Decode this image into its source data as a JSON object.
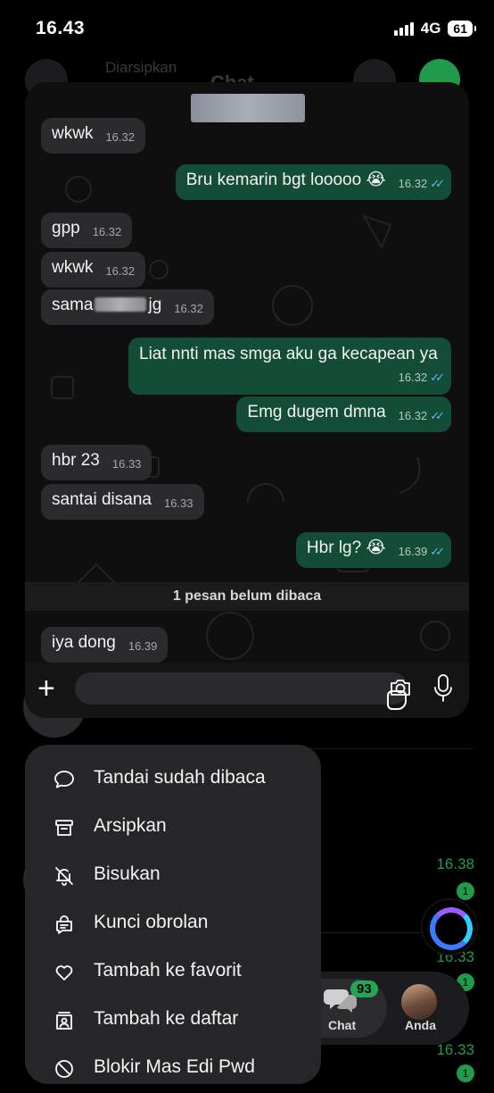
{
  "status": {
    "time": "16.43",
    "network": "4G",
    "battery": "61"
  },
  "background": {
    "title": "Chat",
    "archived": "Diarsipkan",
    "row_times": [
      "16.38",
      "16.33",
      "16.33"
    ],
    "row_badges": [
      "1",
      "1",
      "1"
    ],
    "tabs": {
      "chat_label": "Chat",
      "chat_badge": "93",
      "you_label": "Anda"
    }
  },
  "preview": {
    "messages": [
      {
        "dir": "in",
        "text": "wkwk",
        "time": "16.32"
      },
      {
        "dir": "out",
        "text": "Bru kemarin bgt looooo 😭",
        "time": "16.32"
      },
      {
        "dir": "in",
        "text": "gpp",
        "time": "16.32"
      },
      {
        "dir": "in",
        "text": "wkwk",
        "time": "16.32"
      },
      {
        "dir": "in",
        "text_before": "sama",
        "text_after": "jg",
        "time": "16.32"
      },
      {
        "dir": "out",
        "text": "Liat nnti mas smga aku ga kecapean ya",
        "time": "16.32"
      },
      {
        "dir": "out",
        "text": "Emg dugem dmna",
        "time": "16.32"
      },
      {
        "dir": "in",
        "text": "hbr 23",
        "time": "16.33"
      },
      {
        "dir": "in",
        "text": "santai disana",
        "time": "16.33"
      },
      {
        "dir": "out",
        "text": "Hbr lg? 😭",
        "time": "16.39"
      },
      {
        "dir": "in",
        "text": "iya dong",
        "time": "16.39"
      }
    ],
    "unread_divider": "1 pesan belum dibaca"
  },
  "menu": {
    "items": [
      {
        "label": "Tandai sudah dibaca",
        "icon": "chat-bubble-icon"
      },
      {
        "label": "Arsipkan",
        "icon": "archive-icon"
      },
      {
        "label": "Bisukan",
        "icon": "bell-off-icon"
      },
      {
        "label": "Kunci obrolan",
        "icon": "lock-chat-icon"
      },
      {
        "label": "Tambah ke favorit",
        "icon": "heart-icon"
      },
      {
        "label": "Tambah ke daftar",
        "icon": "list-add-icon"
      },
      {
        "label": "Blokir Mas Edi Pwd",
        "icon": "block-icon"
      }
    ]
  },
  "colors": {
    "outgoing": "#144d37",
    "incoming": "#2b2b2d",
    "accent": "#1f9b4b",
    "read_ticks": "#53bdeb"
  }
}
